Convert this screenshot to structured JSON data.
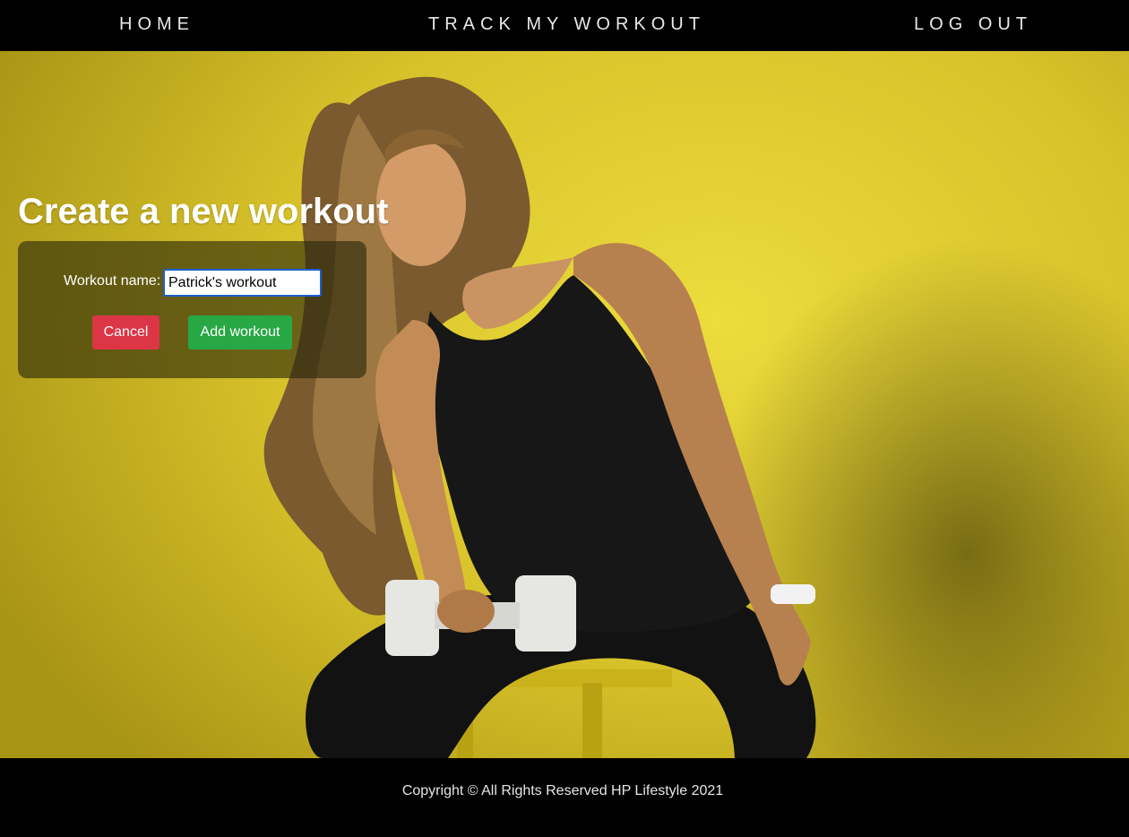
{
  "nav": {
    "home": "HOME",
    "track": "TRACK MY WORKOUT",
    "logout": "LOG OUT"
  },
  "hero": {
    "background_color": "#e8d635",
    "image_subject": "woman-with-dumbbell-photo"
  },
  "form": {
    "title": "Create a new workout",
    "name_label": "Workout name:",
    "name_value": "Patrick's workout",
    "cancel_label": "Cancel",
    "add_label": "Add workout"
  },
  "footer": {
    "copyright": "Copyright © All Rights Reserved HP Lifestyle 2021"
  },
  "colors": {
    "cancel": "#dc3545",
    "add": "#28a745",
    "input_focus": "#1d5fcf"
  }
}
